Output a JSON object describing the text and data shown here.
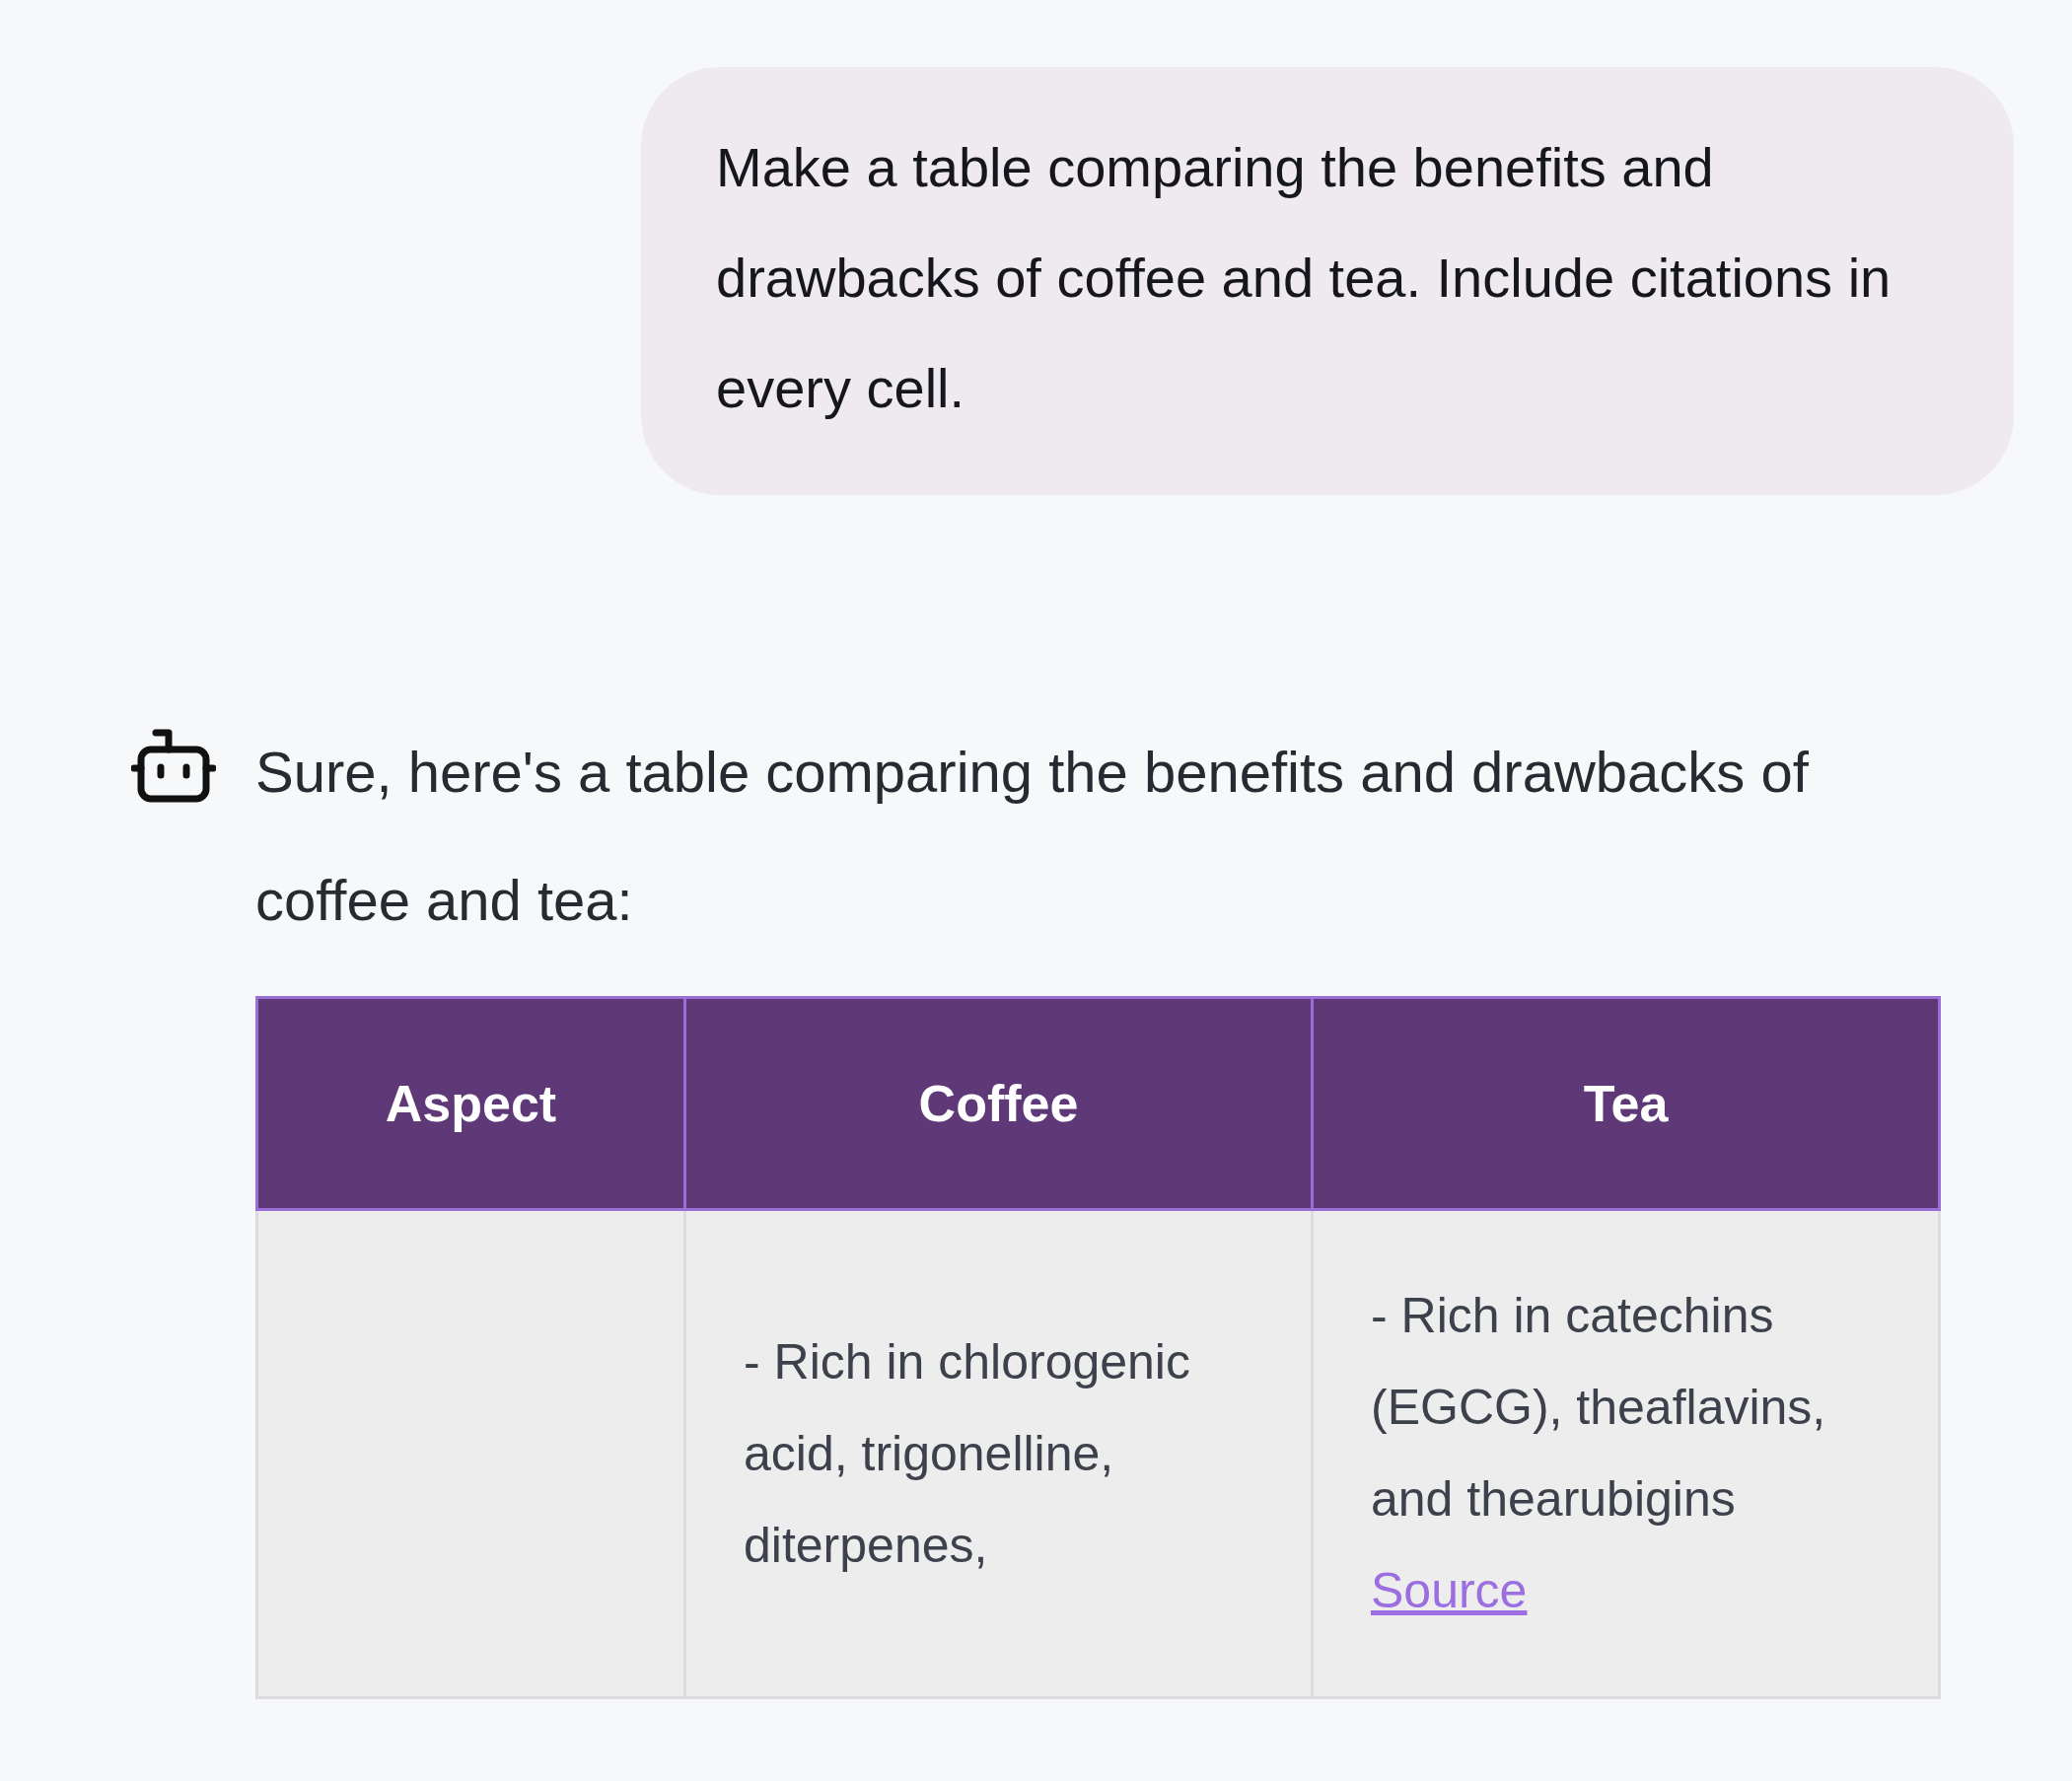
{
  "user_message": {
    "text": "Make a table comparing the benefits and drawbacks of coffee and tea. Include citations in every cell."
  },
  "assistant_message": {
    "text": "Sure, here's a table comparing the benefits and drawbacks of coffee and tea:",
    "table": {
      "columns": [
        "Aspect",
        "Coffee",
        "Tea"
      ],
      "rows": [
        {
          "cells": [
            {
              "text": ""
            },
            {
              "text": "- Rich in chlorogenic acid, trigonelline, diterpenes,"
            },
            {
              "text": "- Rich in catechins (EGCG), theaflavins, and thearubigins",
              "link": "Source"
            }
          ]
        }
      ]
    }
  }
}
